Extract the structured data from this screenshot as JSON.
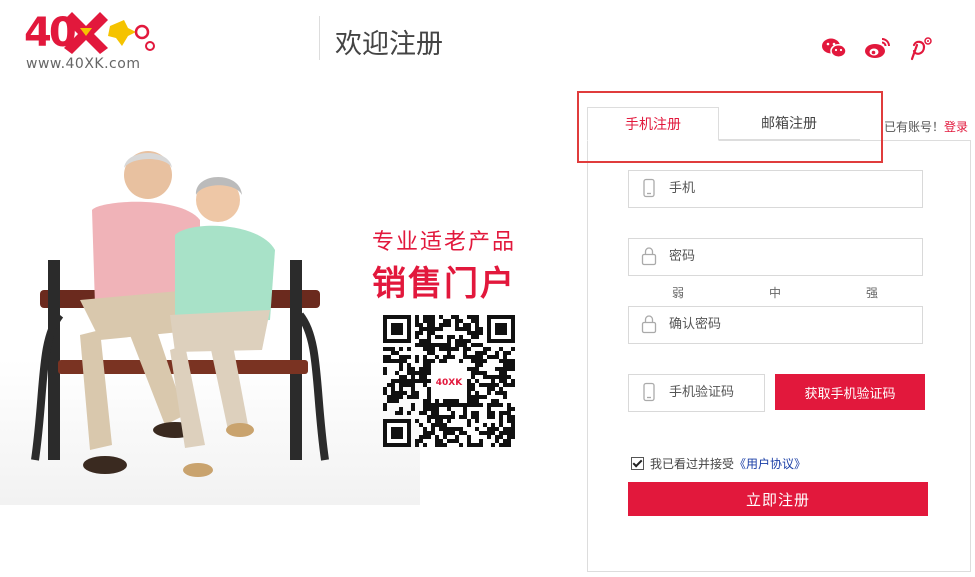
{
  "header": {
    "logo_text": "40XK",
    "logo_url": "www.40XK.com",
    "title": "欢迎注册",
    "social_icons": [
      "wechat-icon",
      "weibo-icon",
      "pinterest-icon"
    ]
  },
  "hero": {
    "tagline1": "专业适老产品",
    "tagline2": "销售门户",
    "qr_center_text": "40XK"
  },
  "tabs": [
    {
      "label": "手机注册",
      "active": true
    },
    {
      "label": "邮箱注册",
      "active": false
    }
  ],
  "account": {
    "prompt": "已有账号！",
    "login_link": "登录"
  },
  "form": {
    "phone_placeholder": "手机",
    "password_placeholder": "密码",
    "strength_levels": [
      "弱",
      "中",
      "强"
    ],
    "confirm_placeholder": "确认密码",
    "sms_placeholder": "手机验证码",
    "sms_button": "获取手机验证码",
    "agree_prefix": "我已看过并接受",
    "agree_link": "《用户协议》",
    "agree_checked": true,
    "submit": "立即注册"
  },
  "colors": {
    "accent": "#e2183c",
    "highlight_border": "#e03c3c",
    "link_blue": "#1a3ea6"
  }
}
